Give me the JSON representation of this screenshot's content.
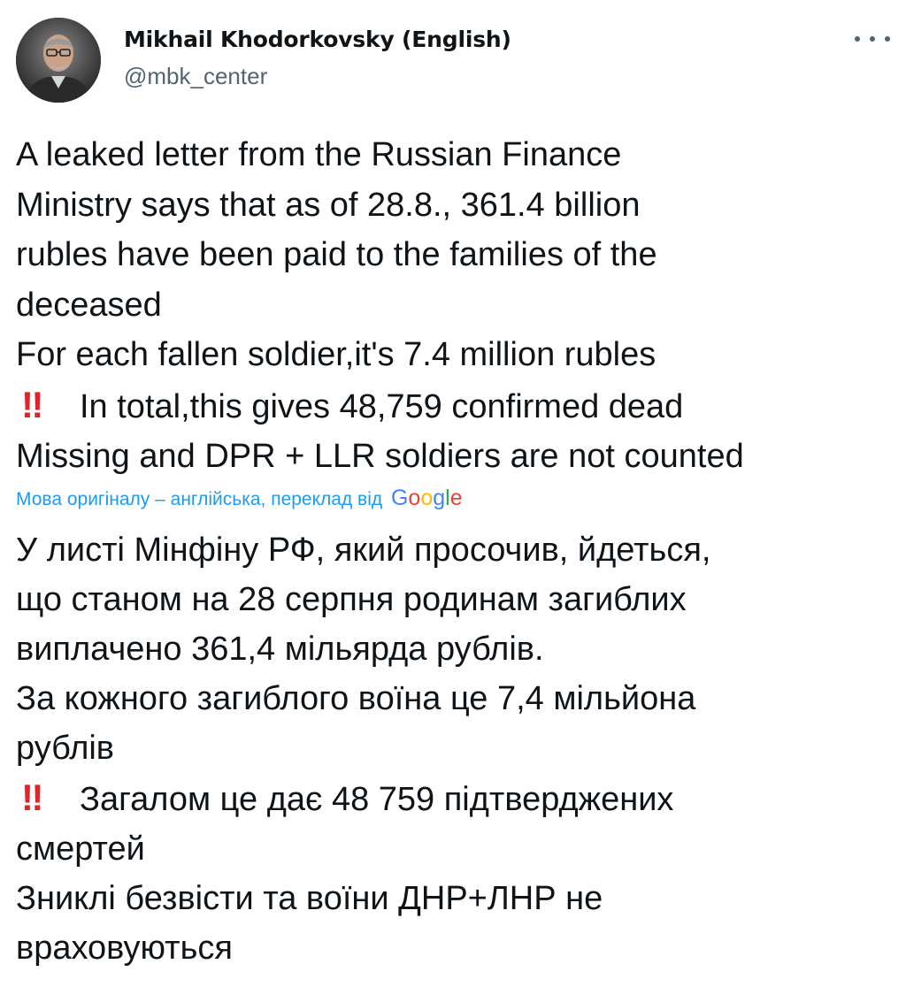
{
  "author": {
    "display_name": "Mikhail Khodorkovsky (English)",
    "handle": "@mbk_center",
    "avatar_icon": "profile-photo-avatar"
  },
  "menu": {
    "icon": "more-options-icon"
  },
  "tweet": {
    "lines": [
      "A leaked letter from the Russian Finance",
      "Ministry says that as of 28.8., 361.4 billion",
      "rubles have been paid to the families of the",
      "deceased",
      "For each fallen soldier,it's 7.4 million rubles",
      "In total,this gives 48,759 confirmed dead",
      "Missing and DPR + LLR soldiers are not counted"
    ],
    "emoji": "‼",
    "emoji_name": "double-exclamation-icon"
  },
  "translation": {
    "notice": "Мова оригіналу – англійська, переклад від",
    "provider": "Google",
    "lines": [
      "У листі Мінфіну РФ, який просочив, йдеться,",
      "що станом на 28 серпня родинам загиблих",
      "виплачено 361,4 мільярда рублів.",
      "За кожного загиблого воїна це 7,4 мільйона",
      "рублів",
      "Загалом це дає 48 759 підтверджених",
      "смертей",
      "Зниклі безвісти та воїни ДНР+ЛНР не",
      "враховуються"
    ]
  },
  "colors": {
    "text": "#0f1419",
    "secondary": "#536471",
    "link": "#1d9bf0",
    "emoji_red": "#e0242c"
  }
}
